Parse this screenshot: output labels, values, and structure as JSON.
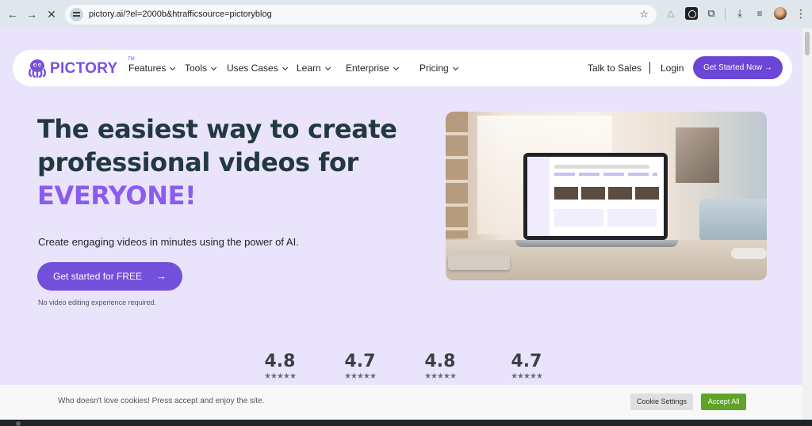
{
  "browser": {
    "url": "pictory.ai/?el=2000b&htrafficsource=pictoryblog",
    "back_icon": "arrow-left-icon",
    "forward_icon": "arrow-right-icon",
    "stop_icon": "close-icon",
    "back_glyph": "←",
    "forward_glyph": "→",
    "stop_glyph": "✕",
    "star_glyph": "☆",
    "menu_glyph": "⋮"
  },
  "navbar": {
    "brand": "PICTORY",
    "tm": "TM",
    "items": [
      {
        "label": "Features"
      },
      {
        "label": "Tools"
      },
      {
        "label": "Uses Cases"
      },
      {
        "label": "Learn"
      },
      {
        "label": "Enterprise"
      },
      {
        "label": "Pricing"
      }
    ],
    "talk_to_sales": "Talk to Sales",
    "login": "Login",
    "cta": "Get Started Now →"
  },
  "hero": {
    "title_line1": "The easiest way to create",
    "title_line2": "professional videos for",
    "title_accent": "EVERYONE!",
    "subtitle": "Create engaging videos in minutes using the power of AI.",
    "cta": "Get started for FREE",
    "cta_arrow": "→",
    "note": "No video editing experience required."
  },
  "ratings": [
    {
      "score": "4.8",
      "stars": "★★★★★"
    },
    {
      "score": "4.7",
      "stars": "★★★★★"
    },
    {
      "score": "4.8",
      "stars": "★★★★★"
    },
    {
      "score": "4.7",
      "stars": "★★★★★"
    }
  ],
  "cookie": {
    "message": "Who doesn't love cookies! Press accept and enjoy the site.",
    "settings": "Cookie Settings",
    "accept": "Accept All"
  },
  "colors": {
    "page_bg": "#e9e4fb",
    "brand_purple": "#7350dc",
    "accent_purple": "#8b5cf0",
    "title_dark": "#22393f",
    "accept_green": "#61a229"
  }
}
